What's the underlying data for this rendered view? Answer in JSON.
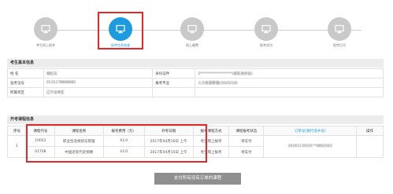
{
  "steps": [
    {
      "label": "考生网上报考",
      "active": false
    },
    {
      "label": "报考信息核查",
      "active": true
    },
    {
      "label": "网上缴费",
      "active": false
    },
    {
      "label": "报考成功",
      "active": false
    },
    {
      "label": "报考打印",
      "active": false
    }
  ],
  "basic_info": {
    "title": "考生基本信息",
    "name_label": "姓    名",
    "name_value": "胡红兵",
    "id_label": "身份证件",
    "id_value": "3******************(居民身份证)",
    "exam_no_label": "准考证号",
    "exam_no_value": "0131178888882",
    "major_label": "报考专业",
    "major_value": "人力资源管理(2020218)",
    "area_label": "所属考区",
    "area_value": "辽宁沈考区"
  },
  "courses": {
    "title": "开考课程信息",
    "headers": [
      "序号",
      "课程代号",
      "课程名称",
      "报考费用（元）",
      "开考日期",
      "报考课程方式",
      "课程报考状态",
      "订单号[银行流水号]",
      "操作"
    ],
    "seq": "1",
    "order_no": "20161130101**9802563",
    "rows": [
      {
        "code": "10052",
        "name": "职业生涯规划与管理",
        "fee": "43.0",
        "date": "2017年04月16日 上午",
        "method": "考生网上报考",
        "status": "待支付"
      },
      {
        "code": "01708",
        "name": "中国近现代史纲要",
        "fee": "43.0",
        "date": "2017年04月15日 上午",
        "method": "考生网上报考",
        "status": "待支付"
      }
    ]
  },
  "pay_button_label": "支付所有没有订单的课程"
}
